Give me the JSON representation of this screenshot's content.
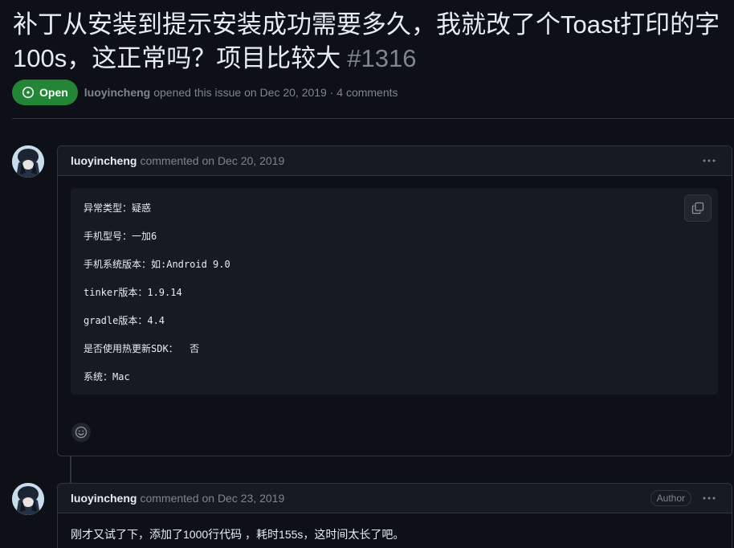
{
  "issue": {
    "title_line1": "补丁从安装到提示安装成功需要多久，我就改了个Toast打印的字",
    "title_line2": "100s，这正常吗？项目比较大",
    "number": "#1316",
    "state": "Open",
    "author": "luoyincheng",
    "opened_text": "opened this issue on Dec 20, 2019 · 4 comments"
  },
  "comments": [
    {
      "author": "luoyincheng",
      "meta": "commented on Dec 20, 2019",
      "code_lines": [
        "异常类型：疑惑",
        "手机型号：一加6",
        "手机系统版本：如:Android 9.0",
        "tinker版本：1.9.14",
        "gradle版本：4.4",
        "是否使用热更新SDK：  否",
        "系统：Mac"
      ]
    },
    {
      "author": "luoyincheng",
      "meta": "commented on Dec 23, 2019",
      "role_badge": "Author",
      "text": "刚才又试了下，添加了1000行代码 ，耗时155s，这时间太长了吧。"
    }
  ],
  "colors": {
    "background": "#0d1117",
    "open_badge": "#238636",
    "border": "#30363d",
    "muted_text": "#7d8590"
  },
  "icons": {
    "state": "issue-opened-icon",
    "menu": "kebab-horizontal-icon",
    "copy": "copy-icon",
    "reaction": "smiley-icon"
  }
}
